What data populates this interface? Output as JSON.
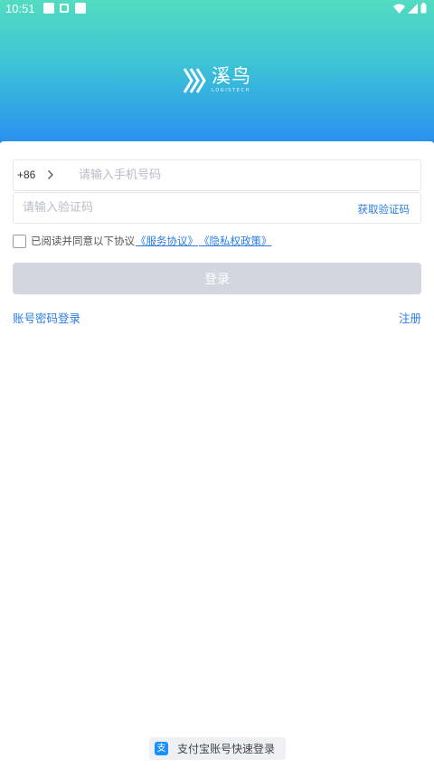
{
  "status_bar": {
    "time": "10:51",
    "icons": [
      "notification-icon",
      "notification-a-icon",
      "notification-icon",
      "wifi-icon",
      "signal-icon",
      "battery-icon"
    ]
  },
  "header": {
    "logo_cn": "溪鸟",
    "logo_en": "LOGISTECH",
    "gradient": [
      "#53dcc0",
      "#3cc3d6",
      "#2a90ef"
    ]
  },
  "form": {
    "country_code": "+86",
    "phone_placeholder": "请输入手机号码",
    "phone_value": "",
    "code_placeholder": "请输入验证码",
    "code_value": "",
    "get_code_label": "获取验证码"
  },
  "agreement": {
    "checked": false,
    "text": "已阅读并同意以下协议",
    "service_link": "《服务协议》",
    "privacy_link": "《隐私权政策》"
  },
  "login_button": "登录",
  "links": {
    "password_login": "账号密码登录",
    "register": "注册"
  },
  "alipay": {
    "icon": "支",
    "label": "支付宝账号快速登录"
  },
  "colors": {
    "accent": "#2a7de1",
    "button_disabled": "#d3d5df",
    "alipay_blue": "#1890ff"
  }
}
